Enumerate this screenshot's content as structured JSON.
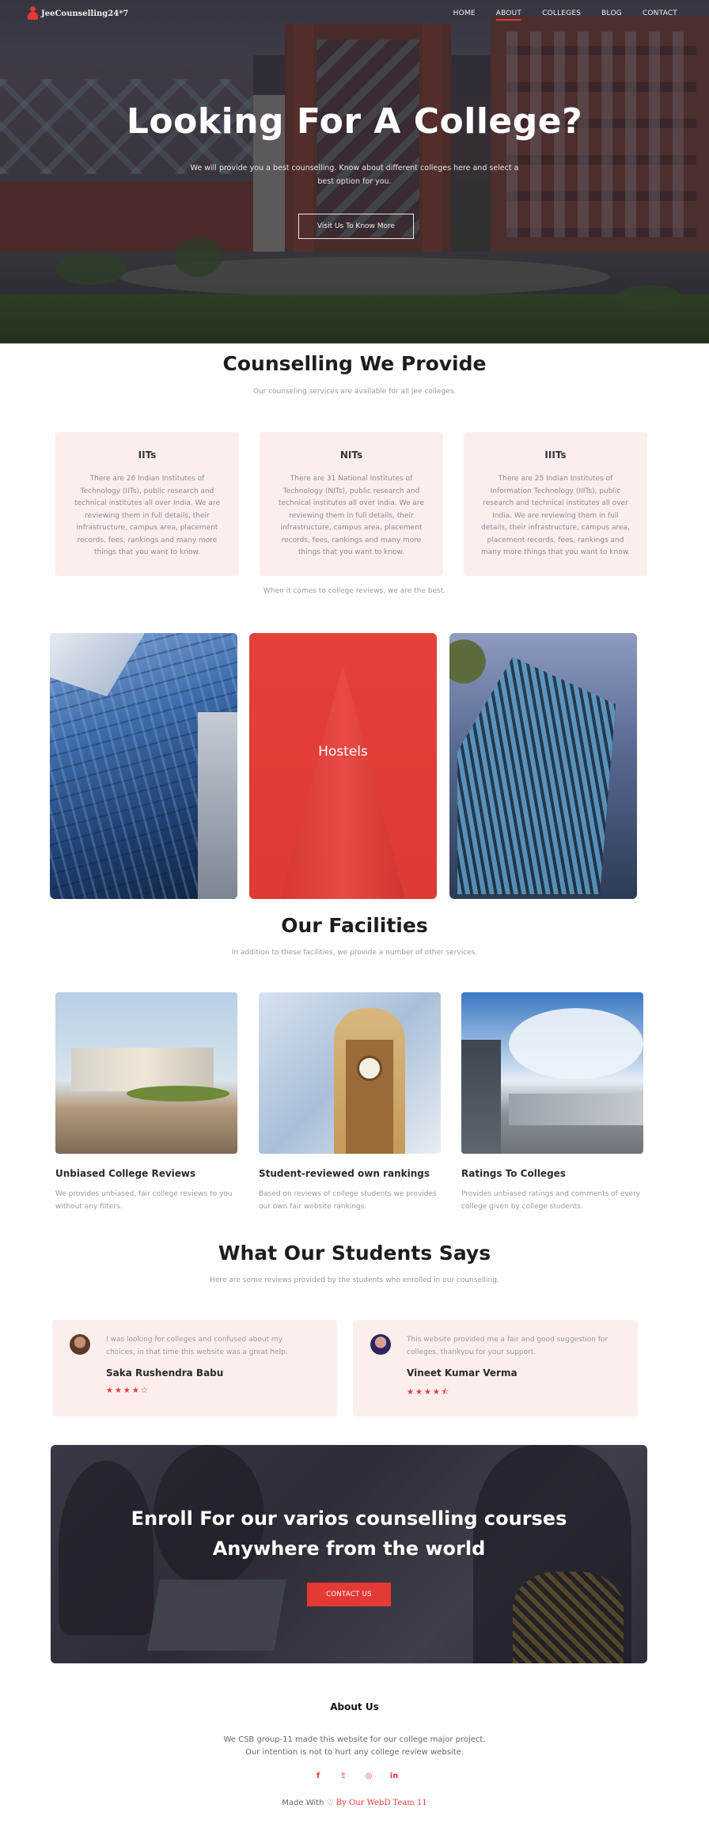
{
  "nav": {
    "brand": "JeeCounselling24*7",
    "items": [
      "HOME",
      "ABOUT",
      "COLLEGES",
      "BLOG",
      "CONTACT"
    ],
    "active": "ABOUT"
  },
  "hero": {
    "title": "Looking For A College?",
    "subtitle": "We will provide you a best counselling. Know about different colleges here and select a best option for you.",
    "button": "Visit Us To Know More"
  },
  "counselling": {
    "title": "Counselling We Provide",
    "subtitle": "Our counseling services are available for all jee colleges.",
    "cards": [
      {
        "title": "IITs",
        "text": "There are 26 Indian Institutes of Technology (IITs), public research and technical institutes all over India. We are reviewing them in full details, their infrastructure, campus area, placement records, fees, rankings and many more things that you want to know."
      },
      {
        "title": "NITs",
        "text": "There are 31 National Institutes of Technology (NITs), public research and technical institutes all over India. We are reviewing them in full details, their infrastructure, campus area, placement records, fees, rankings and many more things that you want to know."
      },
      {
        "title": "IIITs",
        "text": "There are 25 Indian Institutes of Information Technology (IIITs), public research and technical institutes all over India. We are reviewing them in full details, their infrastructure, campus area, placement records, fees, rankings and many more things that you want to know."
      }
    ],
    "footer_line": "When it comes to college reviews, we are the best."
  },
  "tiles": {
    "middle_label": "Hostels"
  },
  "facilities": {
    "title": "Our Facilities",
    "subtitle": "In addition to these facilities, we provide a number of other services.",
    "items": [
      {
        "title": "Unbiased College Reviews",
        "text": "We provides unbiased, fair college reviews to you without any filters."
      },
      {
        "title": "Student-reviewed own rankings",
        "text": "Based on reviews of college students we provides our own fair website rankings."
      },
      {
        "title": "Ratings To Colleges",
        "text": "Provides unbiased ratings and comments of every college given by college students."
      }
    ]
  },
  "testimonials": {
    "title": "What Our Students Says",
    "subtitle": "Here are some reviews provided by the students who enrolled in our counselling.",
    "reviews": [
      {
        "text": "I was looking for colleges and confused about my choices, in that time this website was a great help.",
        "name": "Saka Rushendra Babu",
        "stars": "★★★★☆",
        "rating": 4
      },
      {
        "text": "This website provided me a fair and good suggestion for colleges, thankyou for your support.",
        "name": "Vineet Kumar Verma",
        "stars": "★★★★⯪",
        "rating": 4.5
      }
    ]
  },
  "enroll": {
    "line1": "Enroll For our varios counselling courses",
    "line2": "Anywhere from the world",
    "button": "CONTACT US"
  },
  "footer": {
    "title": "About Us",
    "line1": "We CSB group-11 made this website for our college major project.",
    "line2": "Our intention is not to hurt any college review website.",
    "social": [
      "f",
      "𝕥",
      "◎",
      "in"
    ],
    "made_prefix": "Made With",
    "heart": "♡",
    "made_suffix": "By Our WebD Team 11"
  },
  "colors": {
    "accent": "#e53935",
    "card_bg": "#fdeeee"
  }
}
